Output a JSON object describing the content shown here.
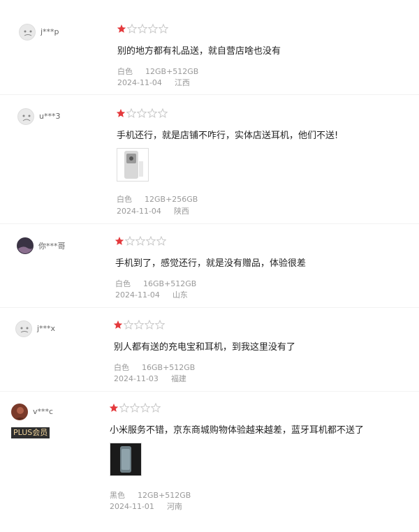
{
  "reviews": [
    {
      "user": "j***p",
      "rating": 1,
      "text": "别的地方都有礼品送，就自营店啥也没有",
      "color": "白色",
      "spec": "12GB+512GB",
      "date": "2024-11-04",
      "location": "江西"
    },
    {
      "user": "u***3",
      "rating": 1,
      "text": "手机还行，就是店铺不咋行，实体店送耳机，他们不送!",
      "color": "白色",
      "spec": "12GB+256GB",
      "date": "2024-11-04",
      "location": "陕西"
    },
    {
      "user": "你***哥",
      "rating": 1,
      "text": "手机到了，感觉还行，就是没有赠品，体验很差",
      "color": "白色",
      "spec": "16GB+512GB",
      "date": "2024-11-04",
      "location": "山东"
    },
    {
      "user": "j***x",
      "rating": 1,
      "text": "别人都有送的充电宝和耳机，到我这里没有了",
      "color": "白色",
      "spec": "16GB+512GB",
      "date": "2024-11-03",
      "location": "福建"
    },
    {
      "user": "v***c",
      "badge": "PLUS会员",
      "rating": 1,
      "text": "小米服务不错，京东商城购物体验越来越差，蓝牙耳机都不送了",
      "color": "黑色",
      "spec": "12GB+512GB",
      "date": "2024-11-01",
      "location": "河南"
    }
  ],
  "colors": {
    "star_filled": "#e4393c",
    "star_empty": "#c8c8c8"
  }
}
